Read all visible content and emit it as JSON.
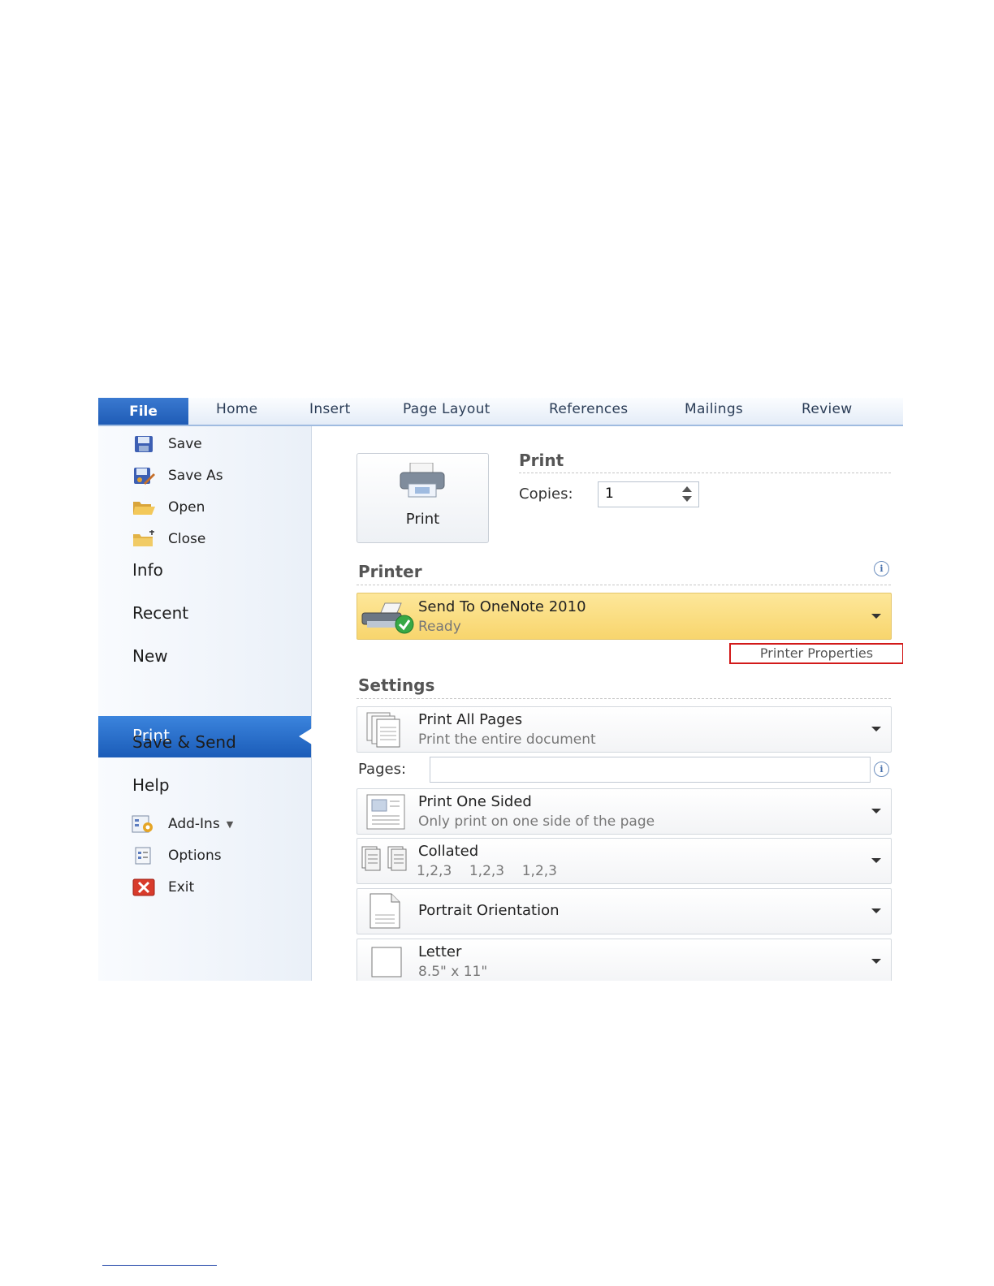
{
  "tabs": {
    "file": "File",
    "items": [
      "Home",
      "Insert",
      "Page Layout",
      "References",
      "Mailings",
      "Review"
    ]
  },
  "nav": {
    "save": "Save",
    "save_as": "Save As",
    "open": "Open",
    "close": "Close",
    "info": "Info",
    "recent": "Recent",
    "new": "New",
    "print": "Print",
    "save_send": "Save & Send",
    "help": "Help",
    "add_ins": "Add-Ins",
    "options": "Options",
    "exit": "Exit"
  },
  "print_section": {
    "button_label": "Print",
    "title": "Print",
    "copies_label": "Copies:",
    "copies_value": "1"
  },
  "printer": {
    "title": "Printer",
    "name": "Send To OneNote 2010",
    "status": "Ready",
    "properties_link": "Printer Properties"
  },
  "settings": {
    "title": "Settings",
    "print_range": {
      "title": "Print All Pages",
      "subtitle": "Print the entire document"
    },
    "pages_label": "Pages:",
    "pages_value": "",
    "sides": {
      "title": "Print One Sided",
      "subtitle": "Only print on one side of the page"
    },
    "collation": {
      "title": "Collated",
      "subtitle": "1,2,3    1,2,3    1,2,3"
    },
    "orientation": {
      "title": "Portrait Orientation"
    },
    "paper": {
      "title": "Letter",
      "subtitle": "8.5\" x 11\""
    }
  },
  "colors": {
    "accent_blue": "#1f5cb6",
    "printer_highlight": "#f8d56d",
    "annotation_red": "#d21a1a"
  }
}
